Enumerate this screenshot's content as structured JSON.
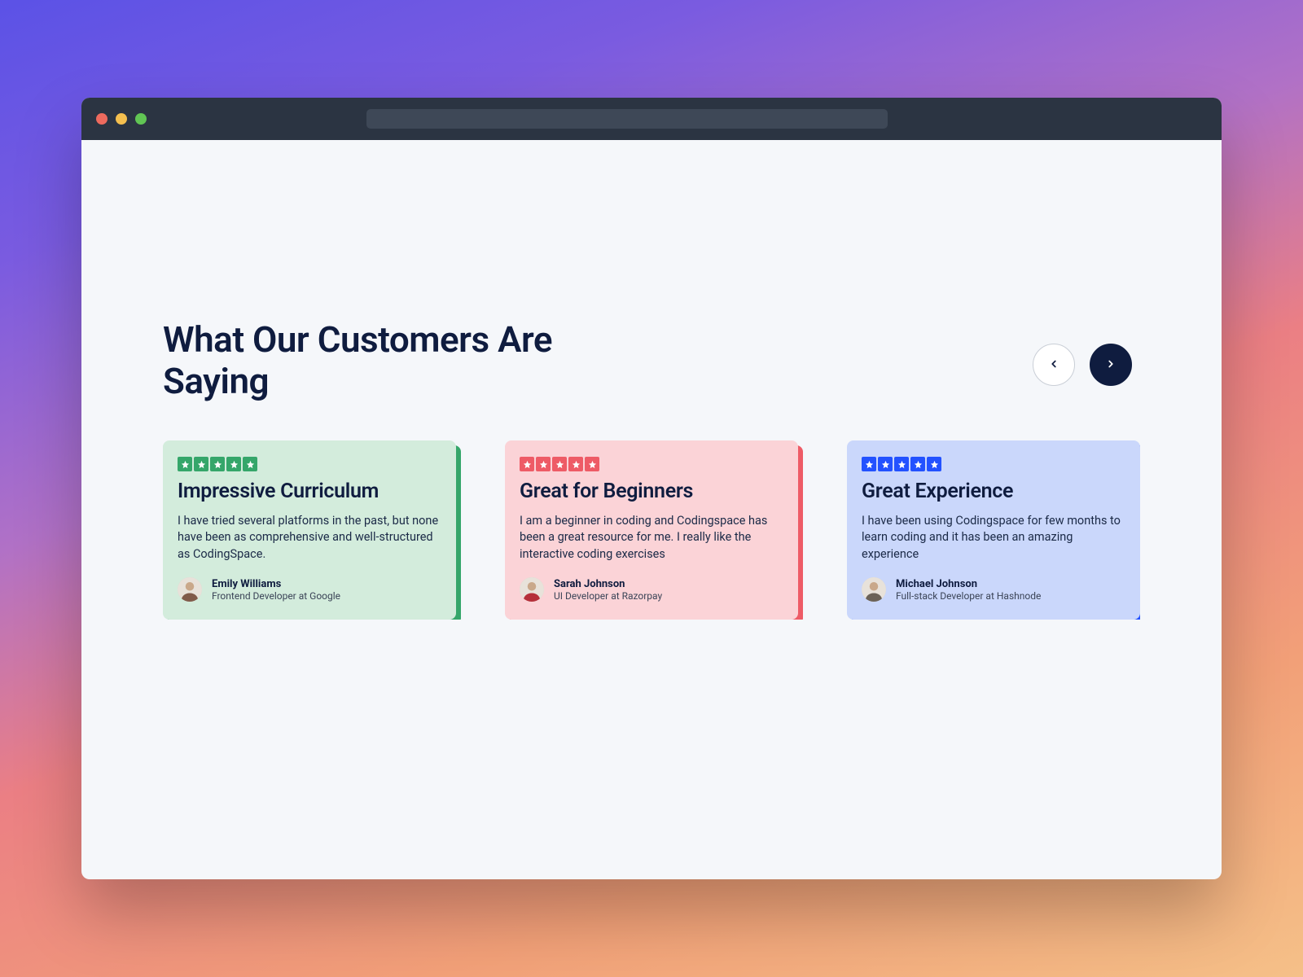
{
  "heading": "What Our Customers Are Saying",
  "colors": {
    "green_accent": "#35a66a",
    "pink_accent": "#ee5b66",
    "blue_accent": "#2352ff",
    "ink": "#0f1c3f"
  },
  "cards": [
    {
      "rating": 5,
      "title": "Impressive Curriculum",
      "body": "I have tried several platforms in the past, but none have been as comprehensive and well-structured as CodingSpace.",
      "author_name": "Emily Williams",
      "author_role": "Frontend Developer at Google"
    },
    {
      "rating": 5,
      "title": "Great for Beginners",
      "body": "I am a beginner in coding and Codingspace has been a great resource for me. I really like the interactive coding exercises",
      "author_name": "Sarah Johnson",
      "author_role": "UI Developer at Razorpay"
    },
    {
      "rating": 5,
      "title": "Great Experience",
      "body": "I have been using Codingspace for few months to learn coding and it has been an amazing experience",
      "author_name": "Michael Johnson",
      "author_role": "Full-stack Developer at Hashnode"
    }
  ]
}
